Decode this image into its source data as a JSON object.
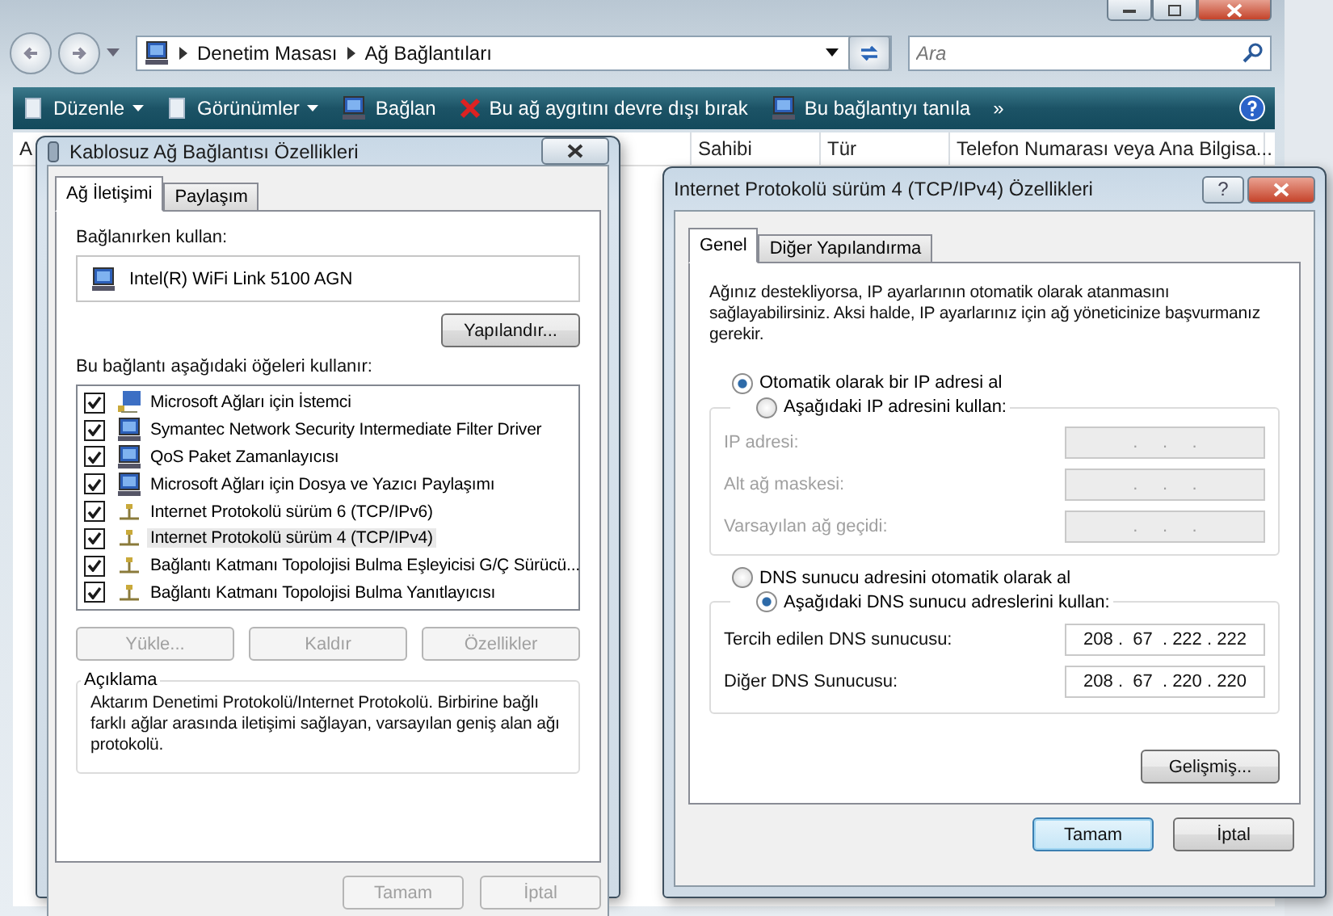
{
  "explorer": {
    "address_path": [
      "Denetim Masası",
      "Ağ Bağlantıları"
    ],
    "search": {
      "placeholder": "Ara"
    },
    "toolbar": [
      {
        "label": "Düzenle",
        "kind": "menu"
      },
      {
        "label": "Görünümler",
        "kind": "menu"
      },
      {
        "label": "Bağlan",
        "kind": "plain"
      },
      {
        "label": "Bu ağ aygıtını devre dışı bırak",
        "kind": "disable"
      },
      {
        "label": "Bu bağlantıyı tanıla",
        "kind": "plain"
      },
      {
        "label": "»",
        "kind": "more"
      }
    ],
    "columns": [
      "A",
      "Sahibi",
      "Tür",
      "Telefon Numarası veya Ana Bilgisa..."
    ]
  },
  "wireless_dialog": {
    "title": "Kablosuz Ağ Bağlantısı Özellikleri",
    "tabs": [
      {
        "label": "Ağ İletişimi",
        "selected": true
      },
      {
        "label": "Paylaşım",
        "selected": false
      }
    ],
    "connect_using_label": "Bağlanırken kullan:",
    "adapter": "Intel(R) WiFi Link 5100 AGN",
    "configure_button": "Yapılandır...",
    "items_label": "Bu bağlantı aşağıdaki öğeleri kullanır:",
    "items": [
      {
        "label": "Microsoft Ağları için İstemci",
        "kind": "client",
        "checked": true,
        "selected": false
      },
      {
        "label": "Symantec Network Security Intermediate Filter Driver",
        "kind": "service",
        "checked": true,
        "selected": false
      },
      {
        "label": "QoS Paket Zamanlayıcısı",
        "kind": "service",
        "checked": true,
        "selected": false
      },
      {
        "label": "Microsoft Ağları için Dosya ve Yazıcı Paylaşımı",
        "kind": "service",
        "checked": true,
        "selected": false
      },
      {
        "label": "Internet Protokolü sürüm 6 (TCP/IPv6)",
        "kind": "protocol",
        "checked": true,
        "selected": false
      },
      {
        "label": "Internet Protokolü sürüm 4 (TCP/IPv4)",
        "kind": "protocol",
        "checked": true,
        "selected": true
      },
      {
        "label": "Bağlantı Katmanı Topolojisi Bulma Eşleyicisi G/Ç Sürücü...",
        "kind": "protocol",
        "checked": true,
        "selected": false
      },
      {
        "label": "Bağlantı Katmanı Topolojisi Bulma Yanıtlayıcısı",
        "kind": "protocol",
        "checked": true,
        "selected": false
      }
    ],
    "item_buttons": [
      {
        "label": "Yükle...",
        "disabled": true
      },
      {
        "label": "Kaldır",
        "disabled": true
      },
      {
        "label": "Özellikler",
        "disabled": true
      }
    ],
    "description": {
      "title": "Açıklama",
      "text": "Aktarım Denetimi Protokolü/Internet Protokolü. Birbirine bağlı farklı ağlar arasında iletişimi sağlayan, varsayılan geniş alan ağı protokolü."
    },
    "buttons": [
      {
        "label": "Tamam",
        "disabled": true,
        "default": false
      },
      {
        "label": "İptal",
        "disabled": true,
        "default": false
      }
    ]
  },
  "ipv4_dialog": {
    "title": "Internet Protokolü sürüm 4 (TCP/IPv4) Özellikleri",
    "help_button": "?",
    "tabs": [
      {
        "label": "Genel",
        "selected": true
      },
      {
        "label": "Diğer Yapılandırma",
        "selected": false
      }
    ],
    "intro": "Ağınız destekliyorsa, IP ayarlarının otomatik olarak atanmasını sağlayabilirsiniz. Aksi halde, IP ayarlarınız için ağ yöneticinize başvurmanız gerekir.",
    "ip_mode": [
      {
        "label": "Otomatik olarak bir IP adresi al",
        "selected": true
      },
      {
        "label": "Aşağıdaki IP adresini kullan:",
        "selected": false
      }
    ],
    "ip_fields": [
      {
        "label": "IP adresi:",
        "value": ".     .     .",
        "disabled": true
      },
      {
        "label": "Alt ağ maskesi:",
        "value": ".     .     .",
        "disabled": true
      },
      {
        "label": "Varsayılan ağ geçidi:",
        "value": ".     .     .",
        "disabled": true
      }
    ],
    "dns_mode": [
      {
        "label": "DNS sunucu adresini otomatik olarak al",
        "selected": false
      },
      {
        "label": "Aşağıdaki DNS sunucu adreslerini kullan:",
        "selected": true
      }
    ],
    "dns_fields": [
      {
        "label": "Tercih edilen DNS sunucusu:",
        "value": "208 .  67  . 222 . 222",
        "disabled": false
      },
      {
        "label": "Diğer DNS Sunucusu:",
        "value": "208 .  67  . 220 . 220",
        "disabled": false
      }
    ],
    "advanced_button": "Gelişmiş...",
    "buttons": [
      {
        "label": "Tamam",
        "disabled": false,
        "default": true
      },
      {
        "label": "İptal",
        "disabled": false,
        "default": false
      }
    ]
  }
}
